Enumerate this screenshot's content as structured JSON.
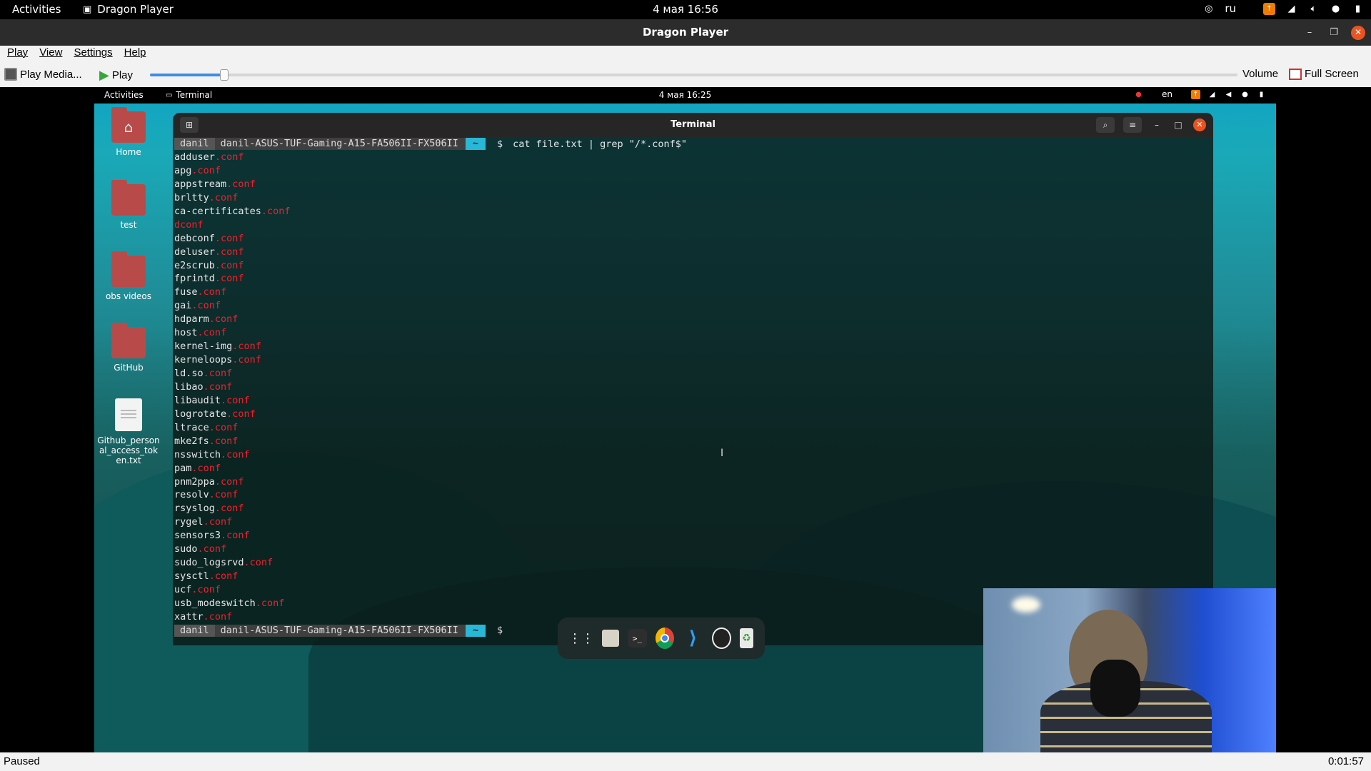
{
  "os_topbar": {
    "activities": "Activities",
    "app_name": "Dragon Player",
    "clock": "4 мая 16:56",
    "layout": "ru"
  },
  "window": {
    "title": "Dragon Player"
  },
  "menu": [
    "Play",
    "View",
    "Settings",
    "Help"
  ],
  "toolbar": {
    "play_media": "Play Media...",
    "play": "Play",
    "volume": "Volume",
    "fullscreen": "Full Screen",
    "progress_fraction": 0.0685
  },
  "video": {
    "inner_topbar": {
      "activities": "Activities",
      "app": "Terminal",
      "clock": "4 мая 16:25",
      "layout": "en"
    },
    "desktop_icons": [
      "Home",
      "test",
      "obs videos",
      "GitHub",
      "Github_personal_access_token.txt"
    ],
    "terminal": {
      "title": "Terminal",
      "prompt": {
        "user": "danil",
        "host": "danil-ASUS-TUF-Gaming-A15-FA506II-FX506II",
        "dir": "~",
        "symbol": "$"
      },
      "command": "cat file.txt | grep \"/*.conf$\"",
      "output": [
        {
          "name": "adduser",
          "ext": ".conf"
        },
        {
          "name": "apg",
          "ext": ".conf"
        },
        {
          "name": "appstream",
          "ext": ".conf"
        },
        {
          "name": "brltty",
          "ext": ".conf"
        },
        {
          "name": "ca-certificates",
          "ext": ".conf"
        },
        {
          "name": "",
          "ext": "dconf"
        },
        {
          "name": "debconf",
          "ext": ".conf"
        },
        {
          "name": "deluser",
          "ext": ".conf"
        },
        {
          "name": "e2scrub",
          "ext": ".conf"
        },
        {
          "name": "fprintd",
          "ext": ".conf"
        },
        {
          "name": "fuse",
          "ext": ".conf"
        },
        {
          "name": "gai",
          "ext": ".conf"
        },
        {
          "name": "hdparm",
          "ext": ".conf"
        },
        {
          "name": "host",
          "ext": ".conf"
        },
        {
          "name": "kernel-img",
          "ext": ".conf"
        },
        {
          "name": "kerneloops",
          "ext": ".conf"
        },
        {
          "name": "ld.so",
          "ext": ".conf"
        },
        {
          "name": "libao",
          "ext": ".conf"
        },
        {
          "name": "libaudit",
          "ext": ".conf"
        },
        {
          "name": "logrotate",
          "ext": ".conf"
        },
        {
          "name": "ltrace",
          "ext": ".conf"
        },
        {
          "name": "mke2fs",
          "ext": ".conf"
        },
        {
          "name": "nsswitch",
          "ext": ".conf"
        },
        {
          "name": "pam",
          "ext": ".conf"
        },
        {
          "name": "pnm2ppa",
          "ext": ".conf"
        },
        {
          "name": "resolv",
          "ext": ".conf"
        },
        {
          "name": "rsyslog",
          "ext": ".conf"
        },
        {
          "name": "rygel",
          "ext": ".conf"
        },
        {
          "name": "sensors3",
          "ext": ".conf"
        },
        {
          "name": "sudo",
          "ext": ".conf"
        },
        {
          "name": "sudo_logsrvd",
          "ext": ".conf"
        },
        {
          "name": "sysctl",
          "ext": ".conf"
        },
        {
          "name": "ucf",
          "ext": ".conf"
        },
        {
          "name": "usb_modeswitch",
          "ext": ".conf"
        },
        {
          "name": "xattr",
          "ext": ".conf"
        }
      ]
    }
  },
  "status": {
    "state": "Paused",
    "time": "0:01:57"
  },
  "colors": {
    "accent": "#e95420",
    "match": "#f5202a",
    "progress": "#3d8de3",
    "prompt_dir": "#28b7d6"
  }
}
